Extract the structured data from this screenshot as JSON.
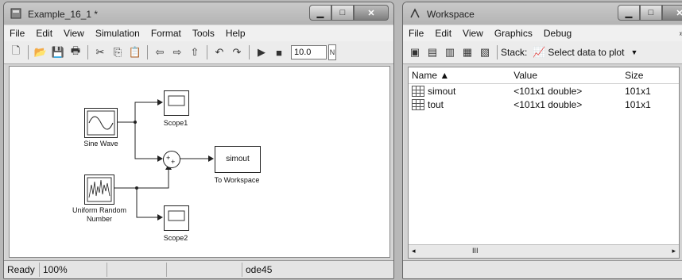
{
  "simulink": {
    "title": "Example_16_1 *",
    "menu": [
      "File",
      "Edit",
      "View",
      "Simulation",
      "Format",
      "Tools",
      "Help"
    ],
    "stop_time": "10.0",
    "blocks": {
      "sine": "Sine Wave",
      "scope1": "Scope1",
      "sum_sign": "+",
      "sum_sign2": "+",
      "simout": "simout",
      "to_workspace": "To Workspace",
      "urn_line1": "Uniform Random",
      "urn_line2": "Number",
      "scope2": "Scope2"
    },
    "status": {
      "ready": "Ready",
      "zoom": "100%",
      "solver": "ode45"
    }
  },
  "workspace": {
    "title": "Workspace",
    "menu": [
      "File",
      "Edit",
      "View",
      "Graphics",
      "Debug"
    ],
    "toolbar": {
      "stack": "Stack:",
      "select": "Select data to plot"
    },
    "columns": {
      "name": "Name ▲",
      "value": "Value",
      "size": "Size"
    },
    "rows": [
      {
        "name": "simout",
        "value": "<101x1 double>",
        "size": "101x1"
      },
      {
        "name": "tout",
        "value": "<101x1 double>",
        "size": "101x1"
      }
    ],
    "scroll_mark": "III"
  }
}
